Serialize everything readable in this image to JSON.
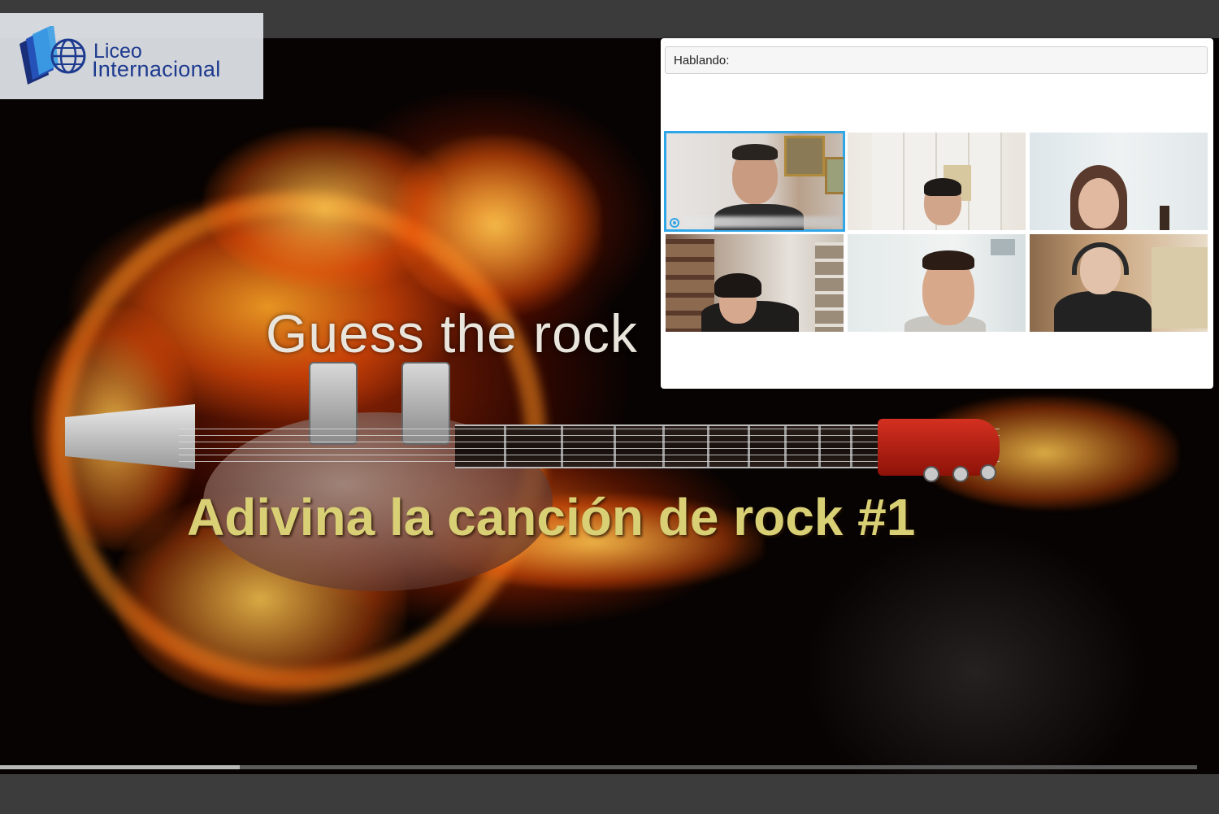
{
  "brand": {
    "name_line1": "Liceo",
    "name_line2": "Internacional",
    "colors": {
      "primary": "#1d3a8f",
      "accent": "#2e7fd6"
    }
  },
  "video": {
    "title_en": "Guess the rock",
    "title_es": "Adivina la canción de rock #1",
    "progress": 0.2
  },
  "call_panel": {
    "speaking_label": "Hablando:",
    "active_color": "#2fa6e8",
    "participants": [
      {
        "id": "p1",
        "active": true,
        "icon": "microphone-icon"
      },
      {
        "id": "p2",
        "active": false
      },
      {
        "id": "p3",
        "active": false
      },
      {
        "id": "p4",
        "active": false
      },
      {
        "id": "p5",
        "active": false
      },
      {
        "id": "p6",
        "active": false
      }
    ]
  }
}
